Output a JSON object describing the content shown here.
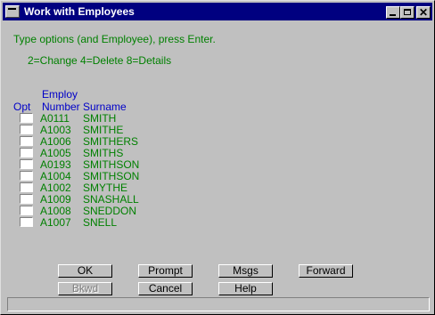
{
  "window": {
    "title": "Work with Employees"
  },
  "instructions": "Type options (and Employee), press Enter.",
  "options_legend": "2=Change 4=Delete 8=Details",
  "columns": {
    "opt": "Opt",
    "number_line1": "Employ",
    "number_line2": "Number",
    "surname": "Surname"
  },
  "rows": [
    {
      "number": "A0111",
      "surname": "SMITH"
    },
    {
      "number": "A1003",
      "surname": "SMITHE"
    },
    {
      "number": "A1006",
      "surname": "SMITHERS"
    },
    {
      "number": "A1005",
      "surname": "SMITHS"
    },
    {
      "number": "A0193",
      "surname": "SMITHSON"
    },
    {
      "number": "A1004",
      "surname": "SMITHSON"
    },
    {
      "number": "A1002",
      "surname": "SMYTHE"
    },
    {
      "number": "A1009",
      "surname": "SNASHALL"
    },
    {
      "number": "A1008",
      "surname": "SNEDDON"
    },
    {
      "number": "A1007",
      "surname": "SNELL"
    }
  ],
  "buttons": {
    "ok": "OK",
    "prompt": "Prompt",
    "msgs": "Msgs",
    "forward": "Forward",
    "bkwd": "Bkwd",
    "cancel": "Cancel",
    "help": "Help"
  },
  "colors": {
    "titlebar": "#000080",
    "text_green": "#008000",
    "text_blue": "#0000c8",
    "face": "#c0c0c0"
  },
  "icons": {
    "minimize": "minimize-icon",
    "maximize": "maximize-icon",
    "close": "close-icon"
  }
}
